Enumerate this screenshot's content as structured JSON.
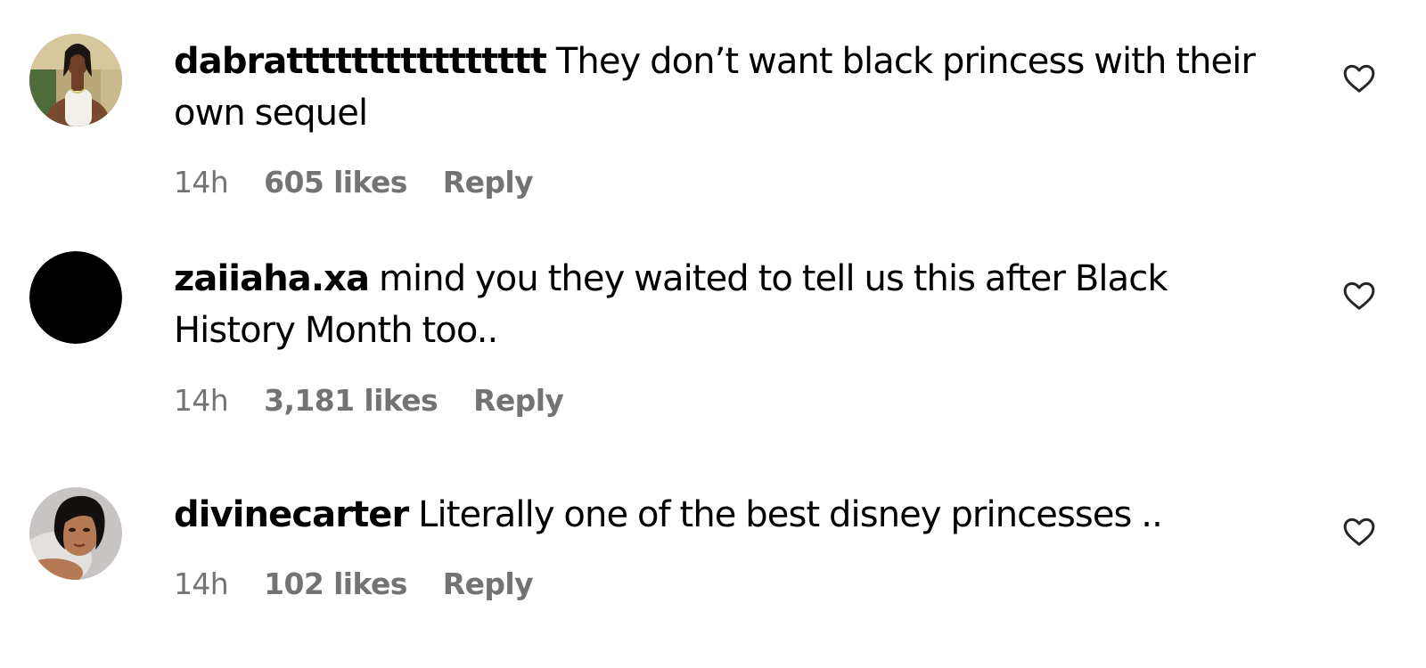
{
  "comments": [
    {
      "username": "dabratttttttttttttttt",
      "text": "They don’t want black princess with their own sequel",
      "time": "14h",
      "likes": "605 likes",
      "reply_label": "Reply",
      "like_icon": "heart-outline-icon",
      "avatar": "profile-photo"
    },
    {
      "username": "zaiiaha.xa",
      "text": "mind you they waited to tell us this after Black History Month too..",
      "time": "14h",
      "likes": "3,181 likes",
      "reply_label": "Reply",
      "like_icon": "heart-outline-icon",
      "avatar": "black-circle"
    },
    {
      "username": "divinecarter",
      "text": "Literally one of the best disney princesses ..",
      "time": "14h",
      "likes": "102 likes",
      "reply_label": "Reply",
      "like_icon": "heart-outline-icon",
      "avatar": "profile-photo"
    }
  ],
  "colors": {
    "text": "#000000",
    "meta": "#737373",
    "background": "#ffffff"
  }
}
